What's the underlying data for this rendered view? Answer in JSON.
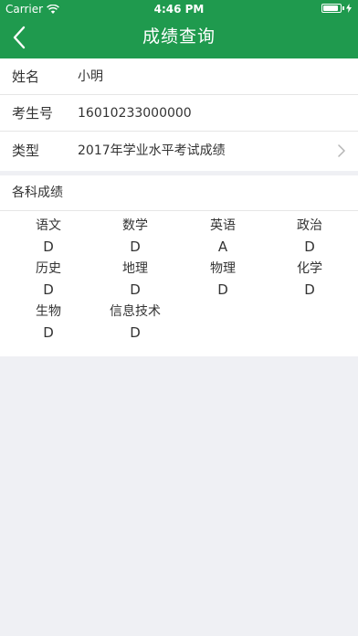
{
  "status_bar": {
    "carrier": "Carrier",
    "time": "4:46 PM",
    "battery_level": 0.9,
    "icons": [
      "wifi-icon",
      "battery-icon",
      "charging-bolt-icon"
    ]
  },
  "nav": {
    "title": "成绩查询",
    "back_icon": "chevron-left-icon",
    "bar_color": "#1f9a4e"
  },
  "info": {
    "name_label": "姓名",
    "name_value": "小明",
    "exam_no_label": "考生号",
    "exam_no_value": "16010233000000",
    "type_label": "类型",
    "type_value": "2017年学业水平考试成绩",
    "type_icon": "chevron-right-icon"
  },
  "scores": {
    "heading": "各科成绩",
    "items": [
      {
        "subject": "语文",
        "grade": "D"
      },
      {
        "subject": "数学",
        "grade": "D"
      },
      {
        "subject": "英语",
        "grade": "A"
      },
      {
        "subject": "政治",
        "grade": "D"
      },
      {
        "subject": "历史",
        "grade": "D"
      },
      {
        "subject": "地理",
        "grade": "D"
      },
      {
        "subject": "物理",
        "grade": "D"
      },
      {
        "subject": "化学",
        "grade": "D"
      },
      {
        "subject": "生物",
        "grade": "D"
      },
      {
        "subject": "信息技术",
        "grade": "D"
      }
    ]
  }
}
